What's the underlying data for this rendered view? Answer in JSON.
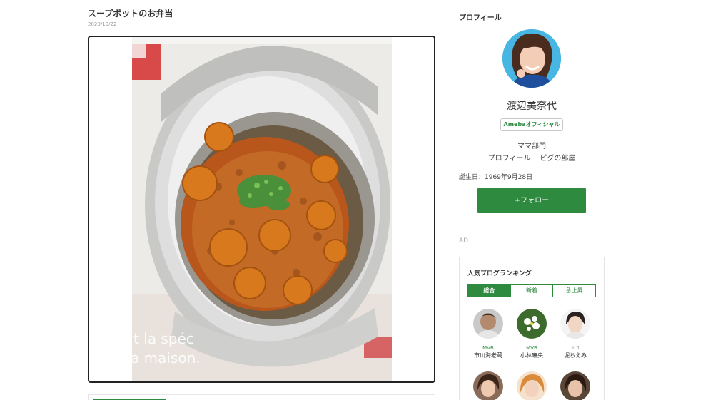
{
  "post": {
    "title": "スープポットのお弁当",
    "date": "2020/10/22",
    "photo_text_line1": "t la spéc",
    "photo_text_line2": "a maison."
  },
  "sidebar": {
    "heading": "プロフィール",
    "name": "渡辺美奈代",
    "official_badge": "Amebaオフィシャル",
    "category": "ママ部門",
    "links": [
      "プロフィール",
      "ピグの部屋"
    ],
    "birthday": "誕生日：1969年9月28日",
    "follow_label": "+フォロー",
    "ad_label": "AD"
  },
  "ranking": {
    "title": "人気ブログランキング",
    "tabs": [
      "総合",
      "新着",
      "急上昇"
    ],
    "items": [
      {
        "badge": "MVB",
        "name": "市川海老蔵"
      },
      {
        "badge": "MVB",
        "name": "小林麻央"
      },
      {
        "badge": "♕ 1",
        "name": "堀ちえみ"
      },
      {
        "badge": "",
        "name": ""
      },
      {
        "badge": "",
        "name": ""
      },
      {
        "badge": "",
        "name": ""
      }
    ]
  },
  "colors": {
    "accent_green": "#2d8a3f",
    "avatar_bg": "#48b6e3"
  }
}
